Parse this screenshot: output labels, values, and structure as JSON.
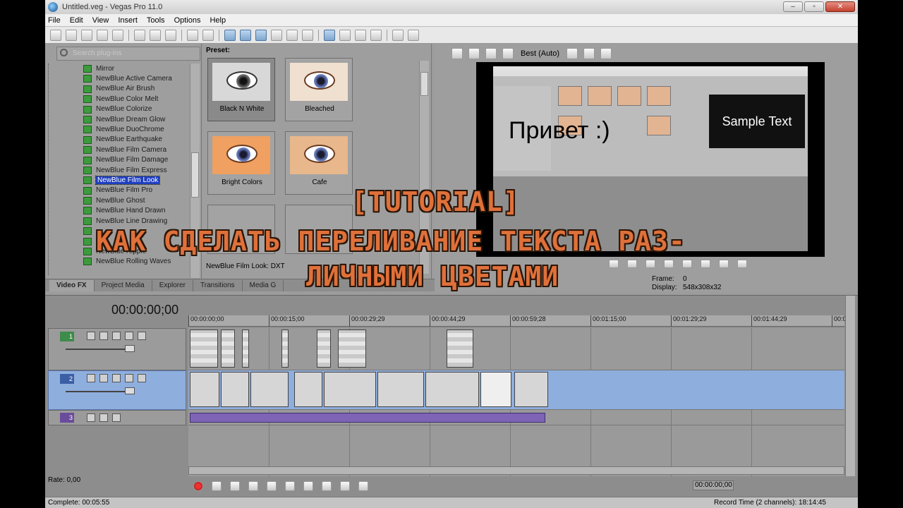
{
  "window": {
    "title": "Untitled.veg - Vegas Pro 11.0",
    "controls": [
      "–",
      "▫",
      "✕"
    ]
  },
  "menu": [
    "File",
    "Edit",
    "View",
    "Insert",
    "Tools",
    "Options",
    "Help"
  ],
  "explorer": {
    "search_placeholder": "Search plug-ins",
    "plugins": [
      "Mirror",
      "NewBlue Active Camera",
      "NewBlue Air Brush",
      "NewBlue Color Melt",
      "NewBlue Colorize",
      "NewBlue Dream Glow",
      "NewBlue DuoChrome",
      "NewBlue Earthquake",
      "NewBlue Film Camera",
      "NewBlue Film Damage",
      "NewBlue Film Express",
      "NewBlue Film Look",
      "NewBlue Film Pro",
      "NewBlue Ghost",
      "NewBlue Hand Drawn",
      "NewBlue Line Drawing",
      "",
      "",
      "NewBlue Ripple",
      "NewBlue Rolling Waves"
    ],
    "selected_plugin": "NewBlue Film Look"
  },
  "presets": {
    "header": "Preset:",
    "items": [
      "Black N White",
      "Bleached",
      "Bright Colors",
      "Cafe"
    ],
    "status": "NewBlue Film Look: DXT"
  },
  "tabs": [
    "Video FX",
    "Project Media",
    "Explorer",
    "Transitions",
    "Media G"
  ],
  "preview": {
    "quality": "Best (Auto)",
    "sample_text": "Sample Text",
    "privet_text": "Привет :)",
    "frame_label": "Frame:",
    "frame_value": "0",
    "display_label": "Display:",
    "display_value": "548x308x32"
  },
  "timeline": {
    "timecode": "00:00:00;00",
    "ruler": [
      "00:00:00;00",
      "00:00:15;00",
      "00:00:29;29",
      "00:00:44;29",
      "00:00:59;28",
      "00:01:15;00",
      "00:01:29;29",
      "00:01:44;29",
      "00:0"
    ],
    "tracks": [
      {
        "num": "1",
        "kind": "video"
      },
      {
        "num": "2",
        "kind": "video"
      },
      {
        "num": "3",
        "kind": "audio"
      }
    ],
    "rate": "Rate: 0,00",
    "cursor_time": "00:00:00;00"
  },
  "status": {
    "left": "Complete: 00:05:55",
    "right": "Record Time (2 channels): 18:14:45"
  },
  "overlay": {
    "line1": "[Tutorial]",
    "line2": "Как сделать переливание текста раз-",
    "line3": "личными цветами"
  },
  "colors": {
    "overlay_text": "#e0703a",
    "selected_track": "#8eaedd",
    "selection": "#1f3fbf"
  }
}
